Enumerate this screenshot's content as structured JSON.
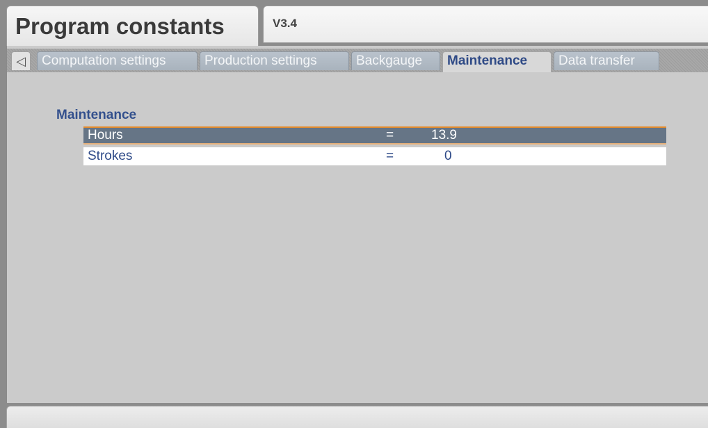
{
  "header": {
    "title": "Program constants",
    "version": "V3.4"
  },
  "tabs": {
    "back_icon": "◁",
    "items": [
      {
        "label": "Computation settings"
      },
      {
        "label": "Production settings"
      },
      {
        "label": "Backgauge"
      },
      {
        "label": "Maintenance",
        "active": true
      },
      {
        "label": "Data transfer"
      }
    ]
  },
  "section": {
    "label": "Maintenance",
    "rows": [
      {
        "label": "Hours",
        "eq": "=",
        "value": "13.9",
        "selected": true
      },
      {
        "label": "Strokes",
        "eq": "=",
        "value": "0",
        "selected": false
      }
    ]
  },
  "colors": {
    "accent": "#33508d",
    "selected_row": "#667586",
    "selection_border": "#e38b2c"
  }
}
